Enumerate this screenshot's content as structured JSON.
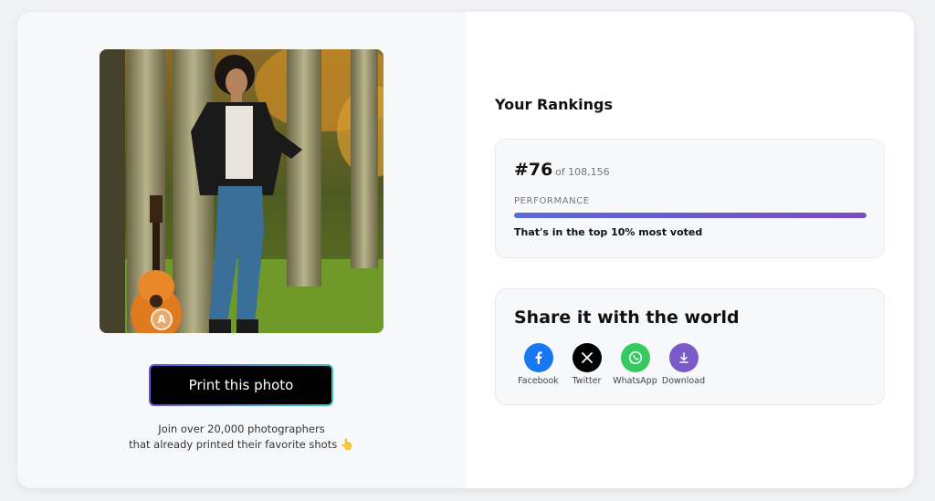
{
  "photo": {
    "alt": "Portrait of a woman leaning against a tree with a guitar",
    "watermark": "A"
  },
  "print_button": {
    "label": "Print this photo"
  },
  "join": {
    "line1": "Join over 20,000 photographers",
    "line2": "that already printed their favorite shots",
    "emoji": "👆"
  },
  "rankings": {
    "title": "Your Rankings",
    "rank": "#76",
    "of_total": "of 108,156",
    "performance_label": "PERFORMANCE",
    "performance_fraction": 1.0,
    "performance_text": "That's in the top 10% most voted"
  },
  "share": {
    "title": "Share it with the world",
    "items": [
      {
        "label": "Facebook",
        "icon": "facebook-icon",
        "color": "#1877f2"
      },
      {
        "label": "Twitter",
        "icon": "x-icon",
        "color": "#000000"
      },
      {
        "label": "WhatsApp",
        "icon": "whatsapp-icon",
        "color": "#35c95f"
      },
      {
        "label": "Download",
        "icon": "download-icon",
        "color": "#7a5bc9"
      }
    ]
  },
  "colors": {
    "accent_start": "#5b6ad8",
    "accent_end": "#7a4cbd",
    "button_border_start": "#6a4fd8",
    "button_border_end": "#3fc6c0"
  }
}
